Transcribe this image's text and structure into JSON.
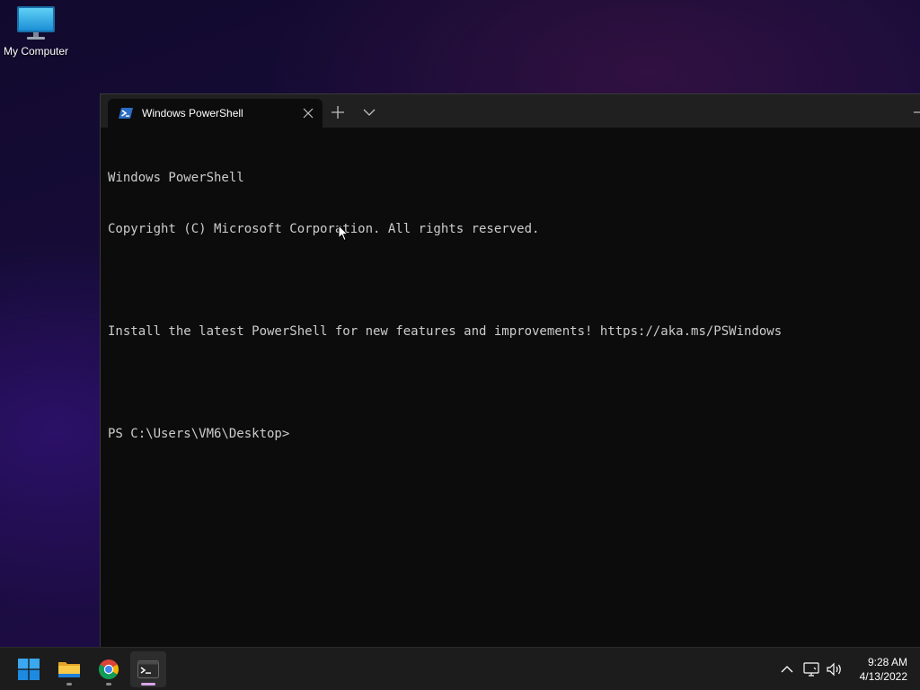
{
  "desktop": {
    "icons": [
      {
        "label": "My Computer",
        "icon": "monitor-icon"
      }
    ]
  },
  "terminal": {
    "tab": {
      "title": "Windows PowerShell",
      "icon": "powershell-icon"
    },
    "titlebar_buttons": [
      "new-tab-icon",
      "chevron-down-icon",
      "minimize-icon"
    ],
    "console_lines": [
      "Windows PowerShell",
      "Copyright (C) Microsoft Corporation. All rights reserved.",
      "",
      "Install the latest PowerShell for new features and improvements! https://aka.ms/PSWindows",
      "",
      "PS C:\\Users\\VM6\\Desktop>"
    ],
    "colors": {
      "background": "#0c0c0c",
      "foreground": "#cccccc",
      "titlebar": "#202020"
    }
  },
  "taskbar": {
    "apps": [
      {
        "name": "start",
        "icon": "windows-start-icon"
      },
      {
        "name": "file-explorer",
        "icon": "folder-icon"
      },
      {
        "name": "chrome",
        "icon": "chrome-icon"
      },
      {
        "name": "terminal",
        "icon": "terminal-icon",
        "active": true
      }
    ],
    "tray": {
      "icons": [
        "chevron-up-icon",
        "network-icon",
        "volume-icon"
      ],
      "time": "9:28 AM",
      "date": "4/13/2022"
    }
  }
}
